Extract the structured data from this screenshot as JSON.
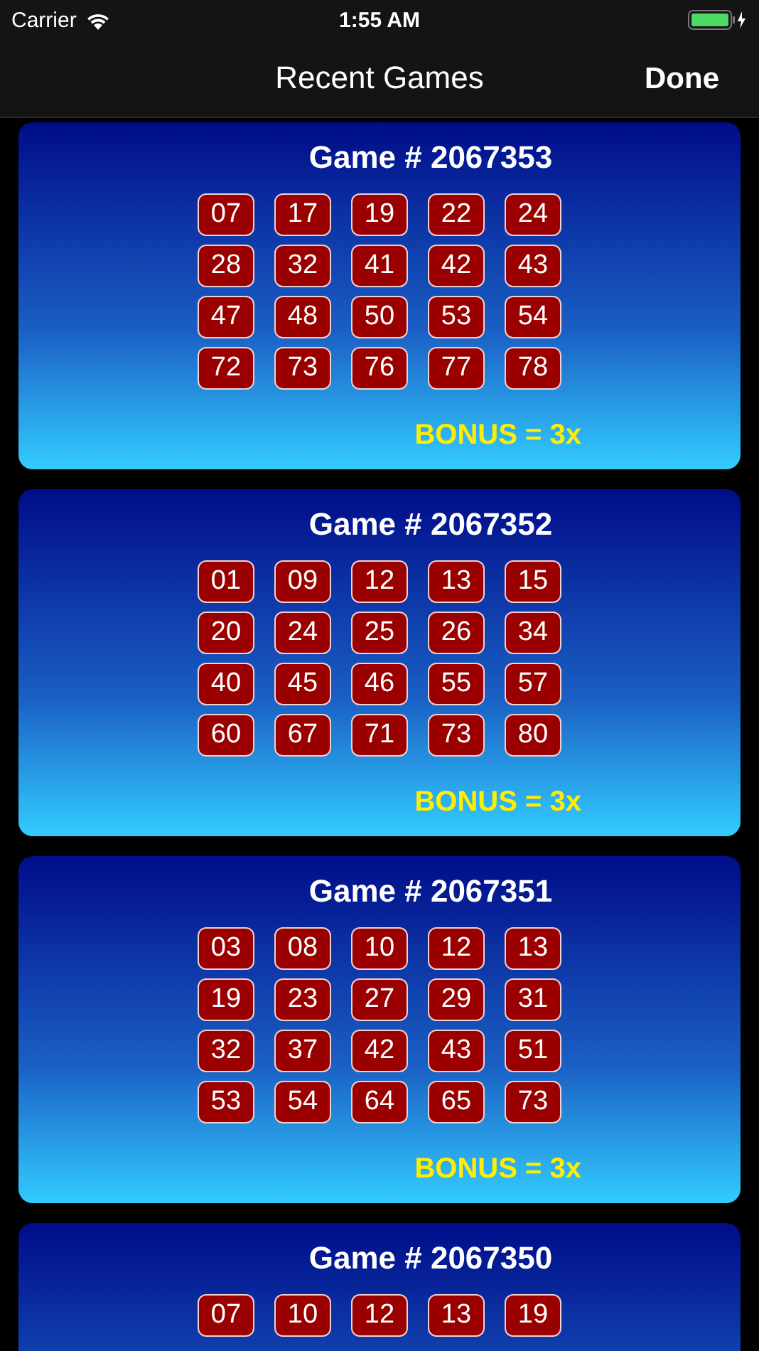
{
  "status_bar": {
    "carrier": "Carrier",
    "time": "1:55 AM"
  },
  "nav": {
    "title": "Recent Games",
    "done": "Done"
  },
  "games": [
    {
      "title": "Game # 2067353",
      "rows": [
        [
          "07",
          "17",
          "19",
          "22",
          "24"
        ],
        [
          "28",
          "32",
          "41",
          "42",
          "43"
        ],
        [
          "47",
          "48",
          "50",
          "53",
          "54"
        ],
        [
          "72",
          "73",
          "76",
          "77",
          "78"
        ]
      ],
      "bonus": "BONUS = 3x"
    },
    {
      "title": "Game # 2067352",
      "rows": [
        [
          "01",
          "09",
          "12",
          "13",
          "15"
        ],
        [
          "20",
          "24",
          "25",
          "26",
          "34"
        ],
        [
          "40",
          "45",
          "46",
          "55",
          "57"
        ],
        [
          "60",
          "67",
          "71",
          "73",
          "80"
        ]
      ],
      "bonus": "BONUS = 3x"
    },
    {
      "title": "Game # 2067351",
      "rows": [
        [
          "03",
          "08",
          "10",
          "12",
          "13"
        ],
        [
          "19",
          "23",
          "27",
          "29",
          "31"
        ],
        [
          "32",
          "37",
          "42",
          "43",
          "51"
        ],
        [
          "53",
          "54",
          "64",
          "65",
          "73"
        ]
      ],
      "bonus": "BONUS = 3x"
    },
    {
      "title": "Game # 2067350",
      "rows": [
        [
          "07",
          "10",
          "12",
          "13",
          "19"
        ]
      ]
    }
  ]
}
